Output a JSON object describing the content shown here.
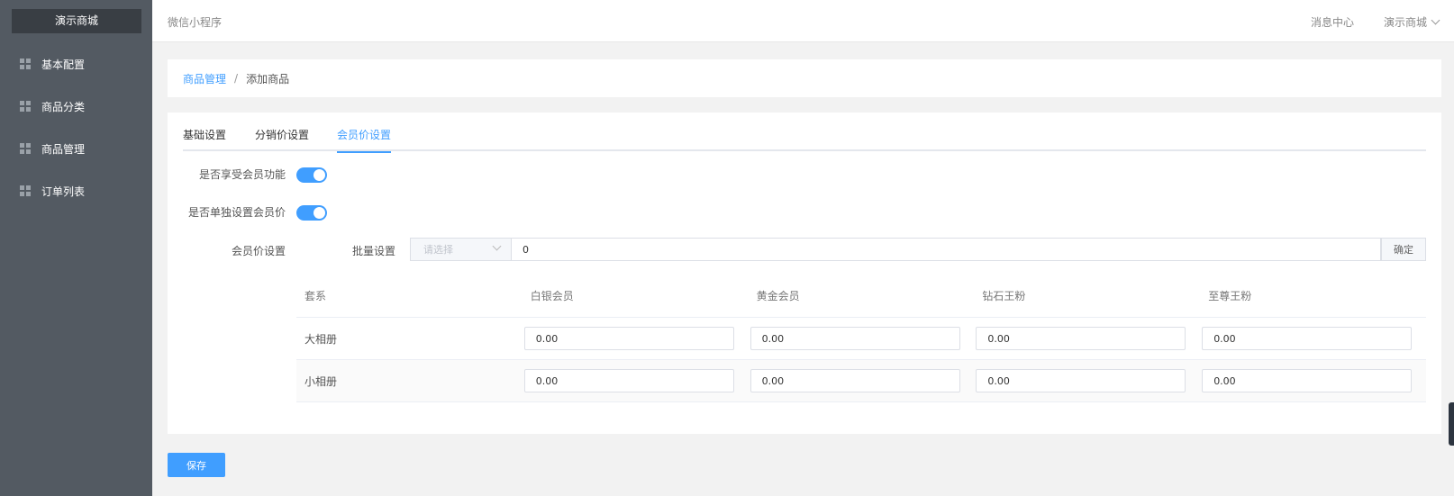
{
  "app": {
    "brand": "演示商城"
  },
  "sidebar": {
    "items": [
      {
        "label": "基本配置"
      },
      {
        "label": "商品分类"
      },
      {
        "label": "商品管理"
      },
      {
        "label": "订单列表"
      }
    ]
  },
  "header": {
    "title": "微信小程序",
    "messages": "消息中心",
    "user": "演示商城"
  },
  "breadcrumb": {
    "parent": "商品管理",
    "separator": "/",
    "current": "添加商品"
  },
  "tabs": [
    {
      "label": "基础设置",
      "active": false
    },
    {
      "label": "分销价设置",
      "active": false
    },
    {
      "label": "会员价设置",
      "active": true
    }
  ],
  "form": {
    "member_enabled_label": "是否享受会员功能",
    "member_enabled": true,
    "separate_price_label": "是否单独设置会员价",
    "separate_price": true,
    "member_price_label": "会员价设置",
    "batch": {
      "label": "批量设置",
      "select_placeholder": "请选择",
      "value": "0",
      "confirm_label": "确定"
    }
  },
  "table": {
    "columns": [
      "套系",
      "白银会员",
      "黄金会员",
      "钻石王粉",
      "至尊王粉"
    ],
    "rows": [
      {
        "name": "大相册",
        "values": [
          "0.00",
          "0.00",
          "0.00",
          "0.00"
        ]
      },
      {
        "name": "小相册",
        "values": [
          "0.00",
          "0.00",
          "0.00",
          "0.00"
        ]
      }
    ]
  },
  "actions": {
    "save_label": "保存"
  },
  "colors": {
    "accent": "#409eff",
    "sidebar_bg": "#535a62",
    "brand_bg": "#393e44"
  }
}
